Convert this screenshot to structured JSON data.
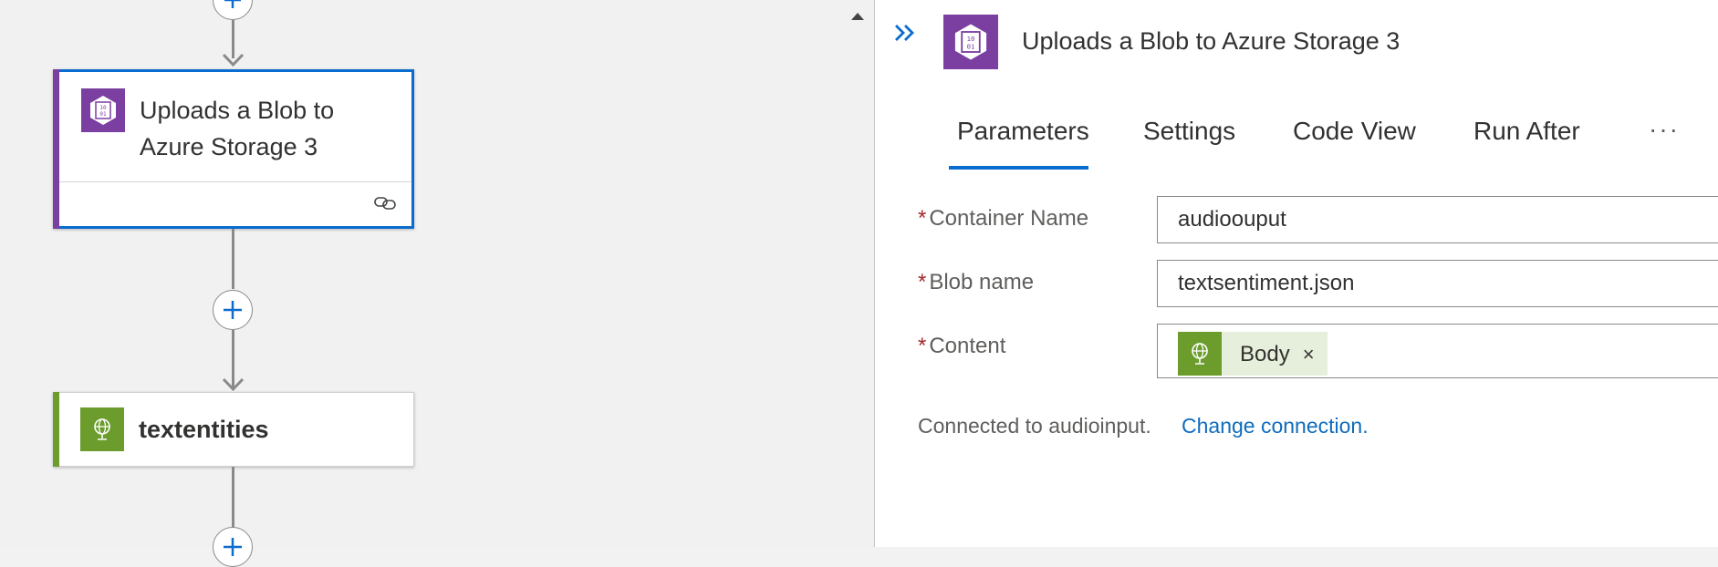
{
  "canvas": {
    "selected_card": {
      "title_line1": "Uploads a Blob to",
      "title_line2": "Azure Storage 3",
      "icon": "blob-storage-icon",
      "accent_color": "#7a3fa0",
      "footer_icon": "link-icon"
    },
    "next_card": {
      "title": "textentities",
      "icon": "globe-icon",
      "accent_color": "#6b9c2c"
    },
    "add_step_icon": "plus-icon"
  },
  "panel": {
    "title": "Uploads a Blob to Azure Storage 3",
    "collapse_icon": "double-chevron-right-icon",
    "tabs": [
      {
        "label": "Parameters",
        "active": true
      },
      {
        "label": "Settings",
        "active": false
      },
      {
        "label": "Code View",
        "active": false
      },
      {
        "label": "Run After",
        "active": false
      }
    ],
    "tabs_more": "···",
    "fields": {
      "container_name": {
        "label": "Container Name",
        "required_mark": "*",
        "value": "audioouput"
      },
      "blob_name": {
        "label": "Blob name",
        "required_mark": "*",
        "value": "textsentiment.json"
      },
      "content": {
        "label": "Content",
        "required_mark": "*",
        "token_label": "Body",
        "token_close": "×"
      }
    },
    "connection": {
      "text": "Connected to audioinput.",
      "link": "Change connection."
    }
  }
}
